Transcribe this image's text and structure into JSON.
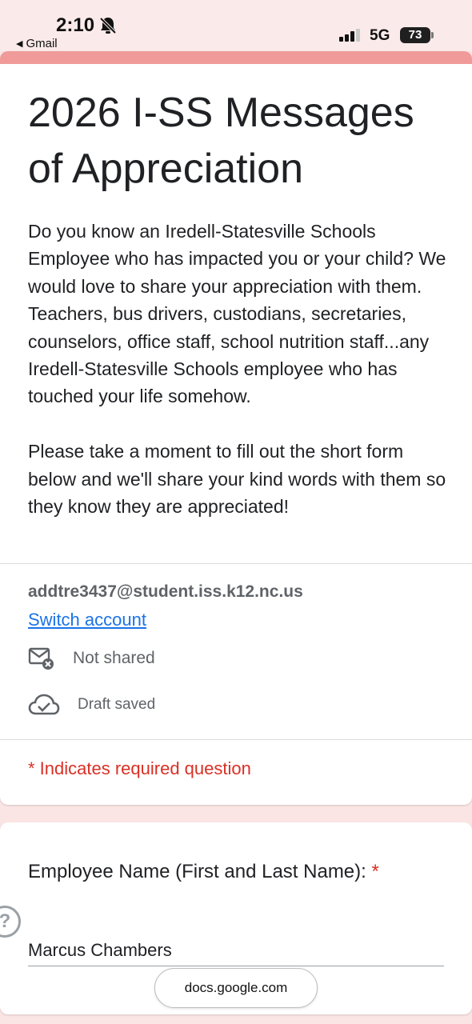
{
  "status_bar": {
    "time": "2:10",
    "back_label": "Gmail",
    "network": "5G",
    "battery": "73"
  },
  "form": {
    "title": "2026 I-SS Messages of Appreciation",
    "description": "Do you know an Iredell-Statesville Schools Employee who has impacted you or your child?  We would love to share your appreciation with them.  Teachers, bus drivers, custodians, secretaries, counselors, office staff, school nutrition staff...any Iredell-Statesville Schools employee who has touched your life somehow.\n\nPlease take a moment to fill out the short form below and we'll share your kind words with them so they know they are appreciated!",
    "account_email": "addtre3437@student.iss.k12.nc.us",
    "switch_account": "Switch account",
    "not_shared": "Not shared",
    "draft_saved": "Draft saved",
    "required_note": "* Indicates required question"
  },
  "question": {
    "label": "Employee Name (First and Last Name):",
    "required_mark": "*",
    "answer": "Marcus Chambers"
  },
  "browser": {
    "url": "docs.google.com"
  }
}
